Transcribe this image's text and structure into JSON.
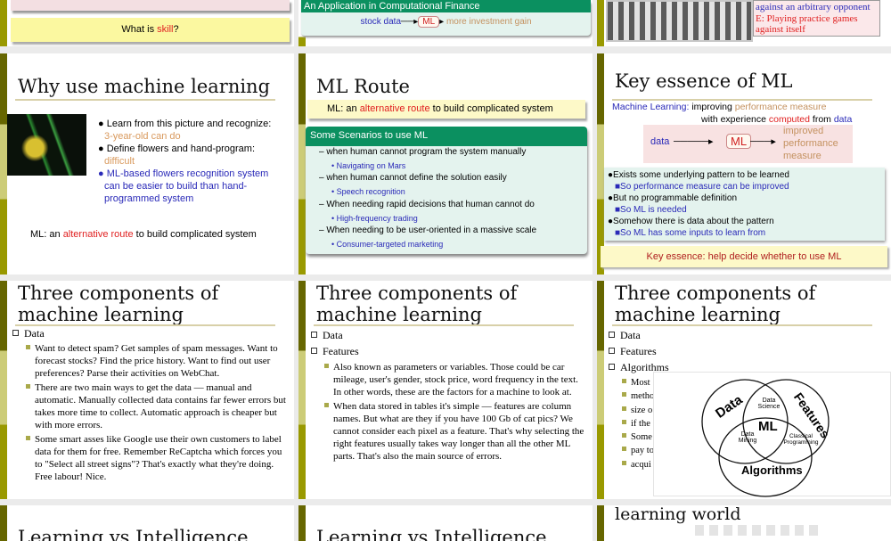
{
  "slides": {
    "s0a": {
      "question_prefix": "What is ",
      "question_highlight": "skill",
      "question_suffix": "?"
    },
    "s0b": {
      "header": "An Application in Computational Finance",
      "input": "stock data",
      "box": "ML",
      "output": "more investment gain"
    },
    "s0c": {
      "line1": "against an arbitrary opponent",
      "line2": "E: Playing practice games",
      "line3": "against itself"
    },
    "why": {
      "title": "Why use machine learning",
      "b1": "Learn from this picture and recognize:",
      "b1s": "3-year-old can do",
      "b2": " Define flowers and hand-program:",
      "b2s": "difficult",
      "b3": "ML-based flowers recognition system can be easier to build than hand-programmed system",
      "foot_pre": "ML: an ",
      "foot_hi": "alternative route",
      "foot_post": " to build complicated system"
    },
    "route": {
      "title": "ML Route",
      "banner_pre": "ML: an ",
      "banner_hi": "alternative route",
      "banner_post": " to build complicated system",
      "box_header": "Some Scenarios to use ML",
      "items": [
        {
          "text": "when human cannot program the system manually",
          "sub": "Navigating on Mars"
        },
        {
          "text": "when human cannot define the solution easily",
          "sub": "Speech recognition"
        },
        {
          "text": "When needing rapid decisions that human cannot do",
          "sub": "High-frequency trading"
        },
        {
          "text": "When needing to be user-oriented in a massive scale",
          "sub": "Consumer-targeted marketing"
        }
      ]
    },
    "essence": {
      "title": "Key essence of ML",
      "def_label": "Machine Learning:",
      "def1_pre": "improving ",
      "def1_hi": "performance measure",
      "def2_pre": "with experience ",
      "def2_hi": "computed",
      "def2_mid": " from ",
      "def2_data": "data",
      "d_in": "data",
      "d_box": "ML",
      "d_out": "improved performance measure",
      "b": [
        {
          "text": "Exists some underlying pattern to be learned",
          "sub": "So performance measure can be improved"
        },
        {
          "text": "But no programmable definition",
          "sub": "So ML is needed"
        },
        {
          "text": "Somehow there is data about the pattern",
          "sub": "So ML has some inputs to learn from"
        }
      ],
      "foot": "Key essence: help decide whether to use ML"
    },
    "three1": {
      "title": "Three components of machine learning",
      "h1": "Data",
      "p": [
        "Want to detect spam? Get samples of spam messages. Want to forecast stocks? Find the price history. Want to find out user preferences? Parse their activities on WebChat.",
        "There are two main ways to get the data — manual and automatic. Manually collected data contains far fewer errors but takes more time to collect. Automatic approach is cheaper but with more errors.",
        "Some smart asses like Google use their own customers to label data for them for free. Remember ReCaptcha which forces you to \"Select all street signs\"? That's exactly what they're doing. Free labour! Nice."
      ]
    },
    "three2": {
      "title": "Three components of machine learning",
      "h1": "Data",
      "h2": "Features",
      "p": [
        "Also known as parameters or variables. Those could be car mileage, user's gender, stock price, word frequency in the text. In other words, these are the factors for a machine to look at.",
        "When data stored in tables it's simple — features are column names. But what are they if you have 100 Gb of cat pics? We cannot consider each pixel as a feature. That's why selecting the right features usually takes way longer than all the other ML parts. That's also the main source of errors."
      ]
    },
    "three3": {
      "title": "Three components of machine learning",
      "h1": "Data",
      "h2": "Features",
      "h3": "Algorithms",
      "p_frag": [
        "Most",
        "metho",
        "size o",
        "if the",
        "Some",
        "pay to",
        "acqui"
      ],
      "venn": {
        "data": "Data",
        "features": "Features",
        "algorithms": "Algorithms",
        "ds": "Data Science",
        "dm": "Data Mining",
        "cp": "Classical Programming",
        "ml": "ML"
      }
    },
    "r3a": {
      "title": "Learning vs Intelligence"
    },
    "r3b": {
      "title": "Learning vs Intelligence"
    },
    "r3c": {
      "title": "learning world"
    }
  }
}
